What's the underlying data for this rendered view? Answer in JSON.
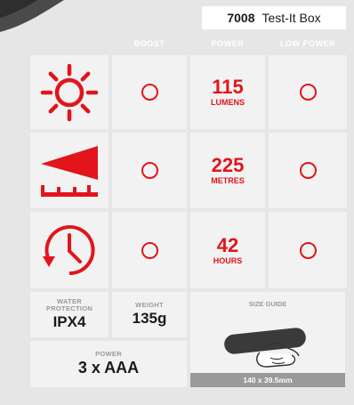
{
  "product": {
    "code": "7008",
    "name": "Test-It Box"
  },
  "columns": {
    "boost": "BOOST",
    "power": "POWER",
    "low_power": "LOW POWER"
  },
  "rows": [
    {
      "icon": "sun-icon",
      "value": "115",
      "unit": "LUMENS"
    },
    {
      "icon": "beam-distance-icon",
      "value": "225",
      "unit": "METRES"
    },
    {
      "icon": "clock-icon",
      "value": "42",
      "unit": "HOURS"
    }
  ],
  "specs": {
    "water_protection": {
      "label_line1": "WATER",
      "label_line2": "PROTECTION",
      "value": "IPX4"
    },
    "weight": {
      "label": "WEIGHT",
      "value": "135g"
    },
    "power": {
      "label": "POWER",
      "value": "3 x AAA"
    },
    "size_guide": {
      "label": "SIZE GUIDE",
      "dimensions": "140 x 39.5mm",
      "image_icon": "hand-holding-torch-icon"
    }
  },
  "colors": {
    "accent": "#e2141c",
    "background": "#e6e6e6",
    "cell": "#f2f2f2",
    "label": "#9a9a9a"
  }
}
